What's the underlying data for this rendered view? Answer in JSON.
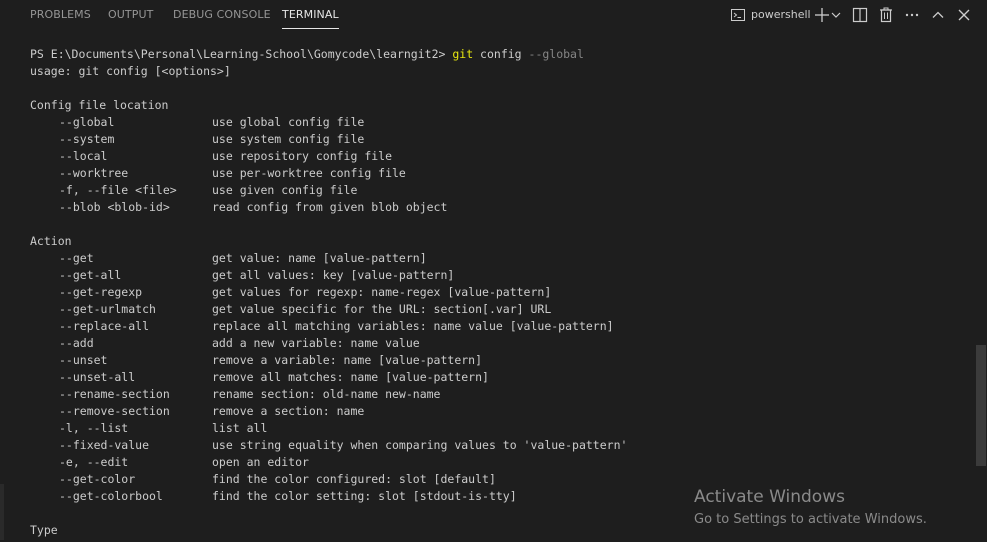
{
  "tabs": {
    "problems": "PROBLEMS",
    "output": "OUTPUT",
    "debug_console": "DEBUG CONSOLE",
    "terminal": "TERMINAL",
    "active": "terminal"
  },
  "toolbar": {
    "shell_name": "powershell",
    "icons": [
      "terminal-icon",
      "plus-icon",
      "chevron-down-icon",
      "split-icon",
      "trash-icon",
      "more-icon",
      "maximize-chevron-up-icon",
      "close-icon"
    ]
  },
  "terminal": {
    "prompt": "PS E:\\Documents\\Personal\\Learning-School\\Gomycode\\learngit2> ",
    "cmd_git": "git",
    "cmd_config": " config ",
    "cmd_flag": "--global",
    "usage": "usage: git config [<options>]",
    "section_config_file": "Config file location",
    "config_options": [
      {
        "opt": "--global",
        "desc": "use global config file"
      },
      {
        "opt": "--system",
        "desc": "use system config file"
      },
      {
        "opt": "--local",
        "desc": "use repository config file"
      },
      {
        "opt": "--worktree",
        "desc": "use per-worktree config file"
      },
      {
        "opt": "-f, --file <file>",
        "desc": "use given config file"
      },
      {
        "opt": "--blob <blob-id>",
        "desc": "read config from given blob object"
      }
    ],
    "section_action": "Action",
    "action_options": [
      {
        "opt": "--get",
        "desc": "get value: name [value-pattern]"
      },
      {
        "opt": "--get-all",
        "desc": "get all values: key [value-pattern]"
      },
      {
        "opt": "--get-regexp",
        "desc": "get values for regexp: name-regex [value-pattern]"
      },
      {
        "opt": "--get-urlmatch",
        "desc": "get value specific for the URL: section[.var] URL"
      },
      {
        "opt": "--replace-all",
        "desc": "replace all matching variables: name value [value-pattern]"
      },
      {
        "opt": "--add",
        "desc": "add a new variable: name value"
      },
      {
        "opt": "--unset",
        "desc": "remove a variable: name [value-pattern]"
      },
      {
        "opt": "--unset-all",
        "desc": "remove all matches: name [value-pattern]"
      },
      {
        "opt": "--rename-section",
        "desc": "rename section: old-name new-name"
      },
      {
        "opt": "--remove-section",
        "desc": "remove a section: name"
      },
      {
        "opt": "-l, --list",
        "desc": "list all"
      },
      {
        "opt": "--fixed-value",
        "desc": "use string equality when comparing values to 'value-pattern'"
      },
      {
        "opt": "-e, --edit",
        "desc": "open an editor"
      },
      {
        "opt": "--get-color",
        "desc": "find the color configured: slot [default]"
      },
      {
        "opt": "--get-colorbool",
        "desc": "find the color setting: slot [stdout-is-tty]"
      }
    ],
    "section_type": "Type"
  },
  "watermark": {
    "title": "Activate Windows",
    "subtitle": "Go to Settings to activate Windows."
  },
  "colors": {
    "background": "#1e1e1e",
    "text": "#cccccc",
    "git_command": "#e5e510",
    "flag": "#858585"
  }
}
